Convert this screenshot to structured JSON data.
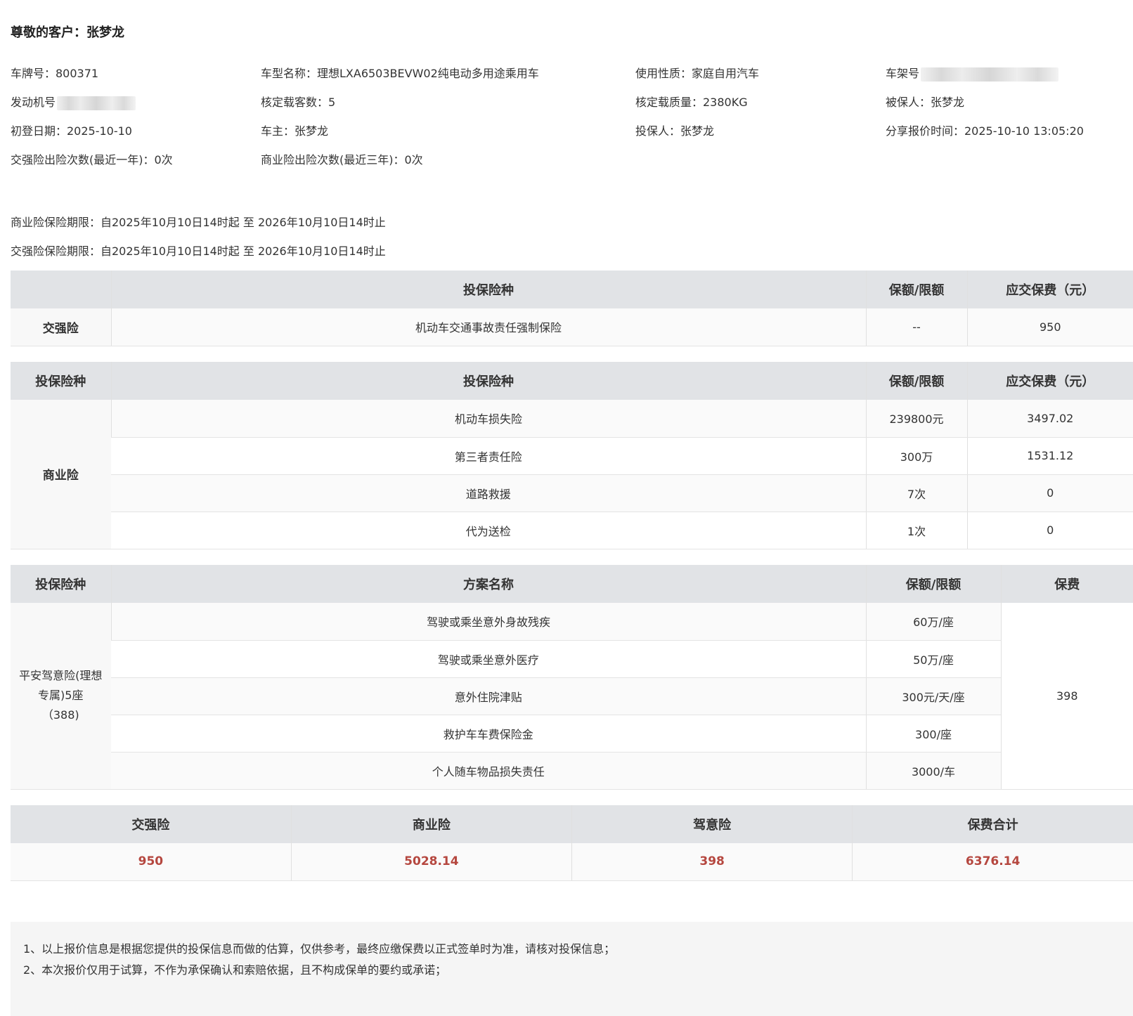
{
  "greeting": "尊敬的客户：张梦龙",
  "info": {
    "plate": "车牌号：800371",
    "model": "车型名称：理想LXA6503BEVW02纯电动多用途乘用车",
    "usage": "使用性质：家庭自用汽车",
    "vin_label": "车架号",
    "engine_label": "发动机号",
    "seats": "核定载客数：5",
    "mass": "核定载质量：2380KG",
    "insured": "被保人：张梦龙",
    "first_reg": "初登日期：2025-10-10",
    "owner": "车主：张梦龙",
    "applicant": "投保人：张梦龙",
    "share_time": "分享报价时间：2025-10-10 13:05:20",
    "ctp_claims": "交强险出险次数(最近一年)：0次",
    "com_claims": "商业险出险次数(最近三年)：0次"
  },
  "periods": {
    "commercial": "商业险保险期限：自2025年10月10日14时起 至 2026年10月10日14时止",
    "ctp": "交强险保险期限：自2025年10月10日14时起 至 2026年10月10日14时止"
  },
  "ctp_table": {
    "headers": [
      "",
      "投保险种",
      "保额/限额",
      "应交保费（元）"
    ],
    "row_label": "交强险",
    "item": "机动车交通事故责任强制保险",
    "amount": "--",
    "premium": "950"
  },
  "commercial_table": {
    "headers": [
      "投保险种",
      "投保险种",
      "保额/限额",
      "应交保费（元）"
    ],
    "row_label": "商业险",
    "rows": [
      {
        "item": "机动车损失险",
        "amount": "239800元",
        "premium": "3497.02"
      },
      {
        "item": "第三者责任险",
        "amount": "300万",
        "premium": "1531.12"
      },
      {
        "item": "道路救援",
        "amount": "7次",
        "premium": "0"
      },
      {
        "item": "代为送检",
        "amount": "1次",
        "premium": "0"
      }
    ]
  },
  "accident_table": {
    "headers": [
      "投保险种",
      "方案名称",
      "保额/限额",
      "保费"
    ],
    "row_label": "平安驾意险(理想专属)5座 （388)",
    "premium": "398",
    "rows": [
      {
        "item": "驾驶或乘坐意外身故残疾",
        "amount": "60万/座"
      },
      {
        "item": "驾驶或乘坐意外医疗",
        "amount": "50万/座"
      },
      {
        "item": "意外住院津贴",
        "amount": "300元/天/座"
      },
      {
        "item": "救护车车费保险金",
        "amount": "300/座"
      },
      {
        "item": "个人随车物品损失责任",
        "amount": "3000/车"
      }
    ]
  },
  "summary": {
    "headers": [
      "交强险",
      "商业险",
      "驾意险",
      "保费合计"
    ],
    "values": [
      "950",
      "5028.14",
      "398",
      "6376.14"
    ],
    "value_color": "#b5473f"
  },
  "notes": [
    "1、以上报价信息是根据您提供的投保信息而做的估算，仅供参考，最终应缴保费以正式签单时为准，请核对投保信息；",
    "2、本次报价仅用于试算，不作为承保确认和索赔依据，且不构成保单的要约或承诺；"
  ]
}
